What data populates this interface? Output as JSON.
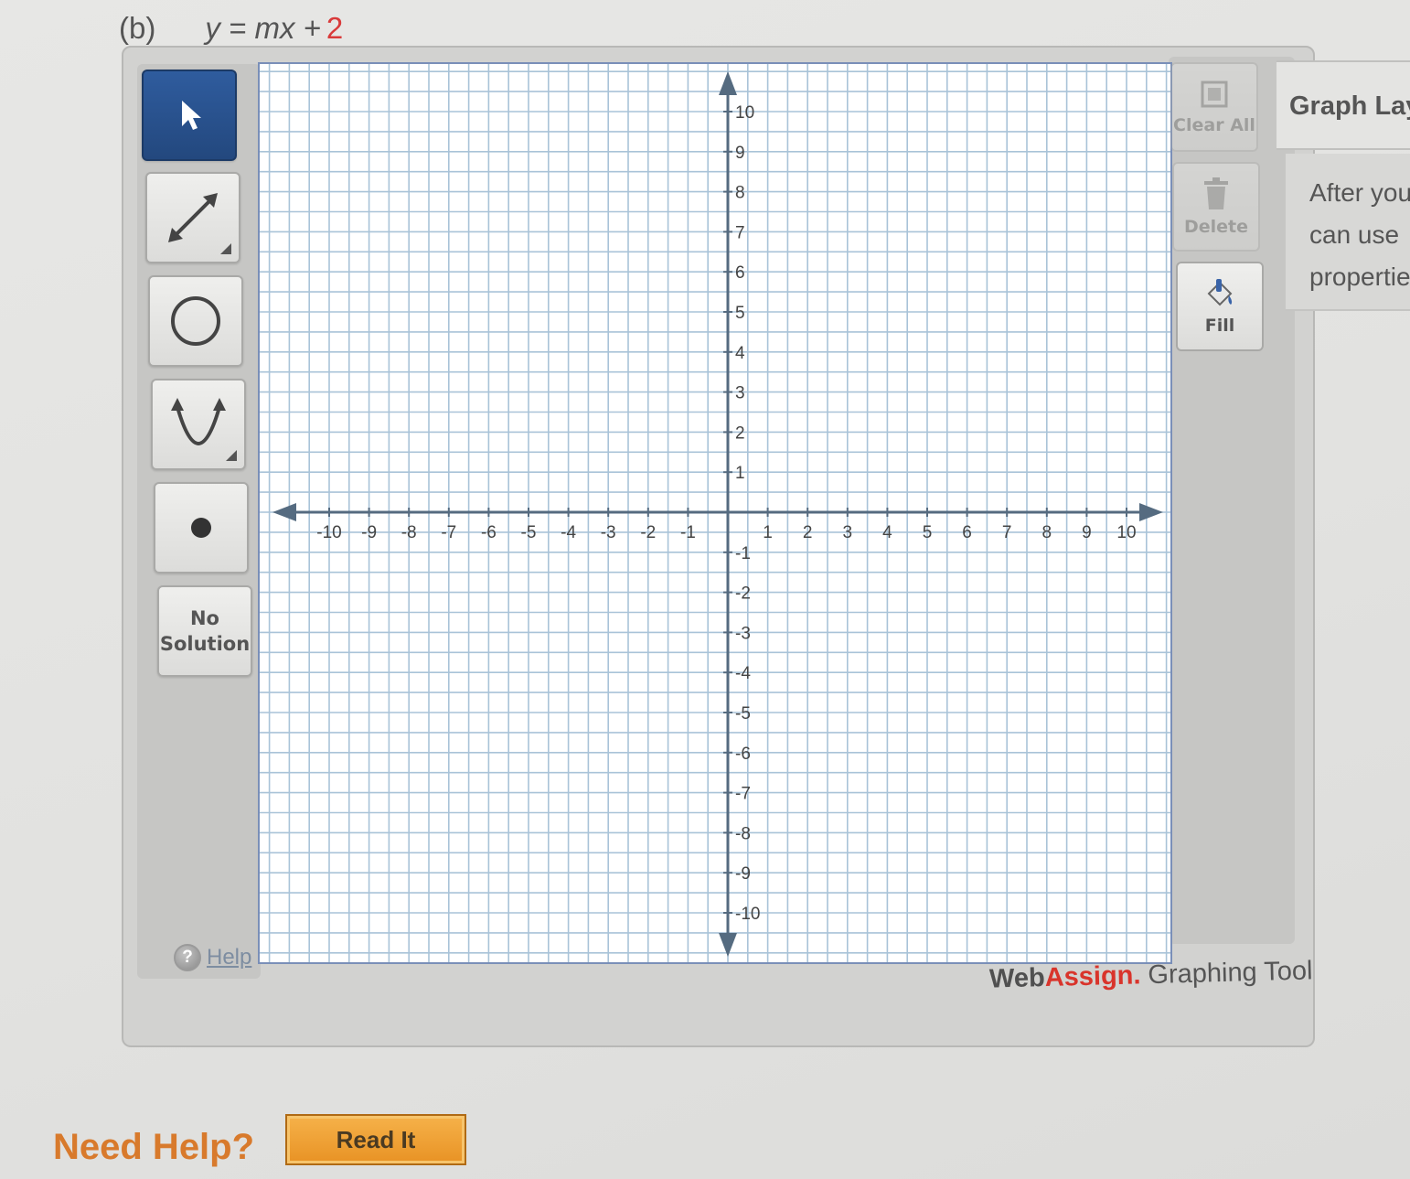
{
  "problem": {
    "part_label": "(b)",
    "equation": "y = mx +",
    "equation_constant": "2"
  },
  "toolbar": {
    "tools": [
      {
        "name": "select-tool",
        "icon": "pointer-arrow-icon",
        "selected": true
      },
      {
        "name": "line-tool",
        "icon": "line-segment-icon",
        "selected": false
      },
      {
        "name": "circle-tool",
        "icon": "circle-icon",
        "selected": false
      },
      {
        "name": "parabola-tool",
        "icon": "parabola-icon",
        "selected": false
      },
      {
        "name": "point-tool",
        "icon": "point-icon",
        "selected": false
      }
    ],
    "no_solution_line1": "No",
    "no_solution_line2": "Solution",
    "help_label": "Help"
  },
  "graph": {
    "x_min": -10,
    "x_max": 10,
    "y_min": -10,
    "y_max": 10,
    "x_ticks": [
      "-10",
      "-9",
      "-8",
      "-7",
      "-6",
      "-5",
      "-4",
      "-3",
      "-2",
      "-1",
      "1",
      "2",
      "3",
      "4",
      "5",
      "6",
      "7",
      "8",
      "9",
      "10"
    ],
    "y_ticks": [
      "10",
      "9",
      "8",
      "7",
      "6",
      "5",
      "4",
      "3",
      "2",
      "1",
      "-1",
      "-2",
      "-3",
      "-4",
      "-5",
      "-6",
      "-7",
      "-8",
      "-9",
      "-10"
    ],
    "grid_color": "#a9c3d8",
    "axis_color": "#556b80"
  },
  "side_actions": {
    "clear_all": "Clear All",
    "delete": "Delete",
    "fill": "Fill"
  },
  "layers_panel": {
    "title": "Graph Lay",
    "body_lines": [
      "After you",
      "can use",
      "propertie"
    ]
  },
  "branding": {
    "web": "Web",
    "assign": "Assign.",
    "rest": "Graphing Tool"
  },
  "help_section": {
    "need_help": "Need Help?",
    "read_it": "Read It"
  },
  "colors": {
    "selected_tool": "#2b5596",
    "need_help": "#d87a2c",
    "read_it_button": "#f0a43a",
    "brand_red": "#d9342b",
    "equation_constant": "#d93a3a"
  }
}
